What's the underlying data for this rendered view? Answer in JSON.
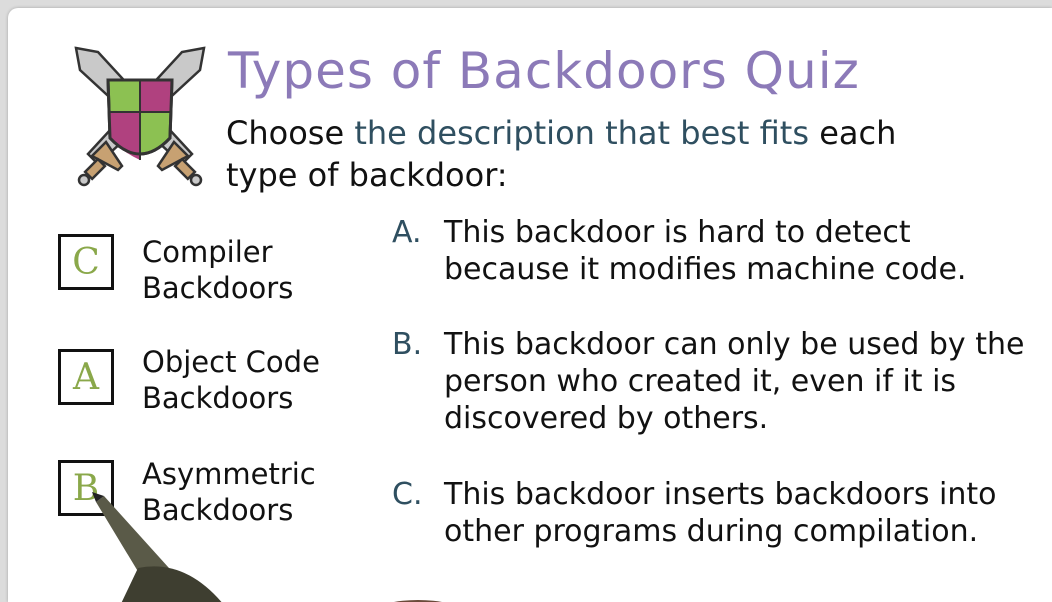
{
  "title": "Types of Backdoors Quiz",
  "instruction": {
    "lead": "Choose ",
    "highlight": "the description that best fits",
    "tail_line1": " each",
    "line2": "type of backdoor:"
  },
  "terms": [
    {
      "answer": "C",
      "label_line1": "Compiler",
      "label_line2": "Backdoors"
    },
    {
      "answer": "A",
      "label_line1": "Object Code",
      "label_line2": "Backdoors"
    },
    {
      "answer": "B",
      "label_line1": "Asymmetric",
      "label_line2": "Backdoors"
    }
  ],
  "options": [
    {
      "letter": "A.",
      "text": "This backdoor is hard to detect because it modifies machine code."
    },
    {
      "letter": "B.",
      "text": "This backdoor can only be used by the person who created it, even if it is discovered by others."
    },
    {
      "letter": "C.",
      "text": "This backdoor inserts backdoors into other programs during compilation."
    }
  ],
  "colors": {
    "title": "#8c7ab8",
    "highlight": "#2f4f60",
    "answer": "#8aa84a",
    "shield_green": "#8cc152",
    "shield_purple": "#b0417f"
  },
  "icons": [
    "crossed-swords-shield-icon",
    "pen-hand-icon"
  ]
}
